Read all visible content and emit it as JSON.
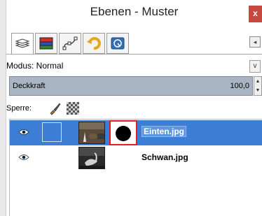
{
  "window": {
    "title": "Ebenen - Muster",
    "close_label": "x"
  },
  "tabs": [
    {
      "name": "layers-tab-icon",
      "active": true
    },
    {
      "name": "channels-tab-icon",
      "active": false
    },
    {
      "name": "paths-tab-icon",
      "active": false
    },
    {
      "name": "undo-history-tab-icon",
      "active": false
    },
    {
      "name": "help-tab-icon",
      "active": false
    }
  ],
  "tab_menu_label": "◂",
  "mode": {
    "label": "Modus: Normal",
    "dropdown_label": "v"
  },
  "opacity": {
    "label": "Deckkraft",
    "value": "100,0"
  },
  "lock": {
    "label": "Sperre:"
  },
  "layers": [
    {
      "name": "Einten.jpg",
      "selected": true,
      "visible": true,
      "has_mask": true
    },
    {
      "name": "Schwan.jpg",
      "selected": false,
      "visible": true,
      "has_mask": false
    }
  ],
  "colors": {
    "selection": "#3c7ed6",
    "slider": "#a8b4c1",
    "mask_border": "#e02020",
    "close": "#c7483e"
  }
}
